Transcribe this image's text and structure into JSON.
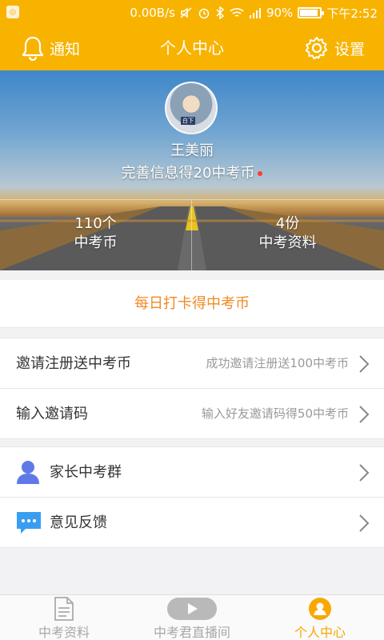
{
  "status_bar": {
    "speed": "0.00B/s",
    "battery": "90%",
    "time": "下午2:52",
    "battery_level": 0.9
  },
  "header": {
    "notify_label": "通知",
    "title": "个人中心",
    "settings_label": "设置"
  },
  "profile": {
    "avatar_caption": "白下",
    "name": "王美丽",
    "complete_prompt": "完善信息得20中考币"
  },
  "stats": [
    {
      "value": "110个",
      "label": "中考币"
    },
    {
      "value": "4份",
      "label": "中考资料"
    }
  ],
  "checkin": {
    "label": "每日打卡得中考币"
  },
  "invite": [
    {
      "label": "邀请注册送中考币",
      "desc": "成功邀请注册送100中考币"
    },
    {
      "label": "输入邀请码",
      "desc": "输入好友邀请码得50中考币"
    }
  ],
  "misc": [
    {
      "label": "家长中考群",
      "icon": "parent-group-icon"
    },
    {
      "label": "意见反馈",
      "icon": "feedback-icon"
    }
  ],
  "nav": [
    {
      "label": "中考资料",
      "icon": "document-icon",
      "active": false
    },
    {
      "label": "中考君直播间",
      "icon": "play-icon",
      "active": false
    },
    {
      "label": "个人中心",
      "icon": "user-icon",
      "active": true
    }
  ],
  "colors": {
    "accent": "#f8b300",
    "checkin": "#f08a24",
    "active_nav": "#f8a800"
  }
}
